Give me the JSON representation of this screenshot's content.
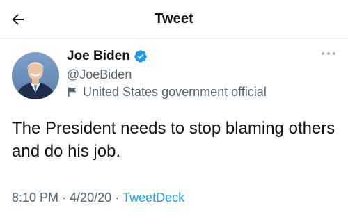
{
  "header": {
    "title": "Tweet",
    "back_icon": "arrow-left-icon"
  },
  "tweet": {
    "author": {
      "display_name": "Joe Biden",
      "handle": "@JoeBiden",
      "verified": true,
      "label": "United States government official"
    },
    "text": "The President needs to stop blaming others and do his job.",
    "time": "8:10 PM",
    "separator": "·",
    "date": "4/20/20",
    "source": "TweetDeck"
  },
  "colors": {
    "accent": "#1d9bf0",
    "secondary_text": "#536471",
    "primary_text": "#0f1419"
  },
  "icons": {
    "verified": "verified-badge-icon",
    "label": "flag-icon",
    "more": "more-options-icon"
  }
}
